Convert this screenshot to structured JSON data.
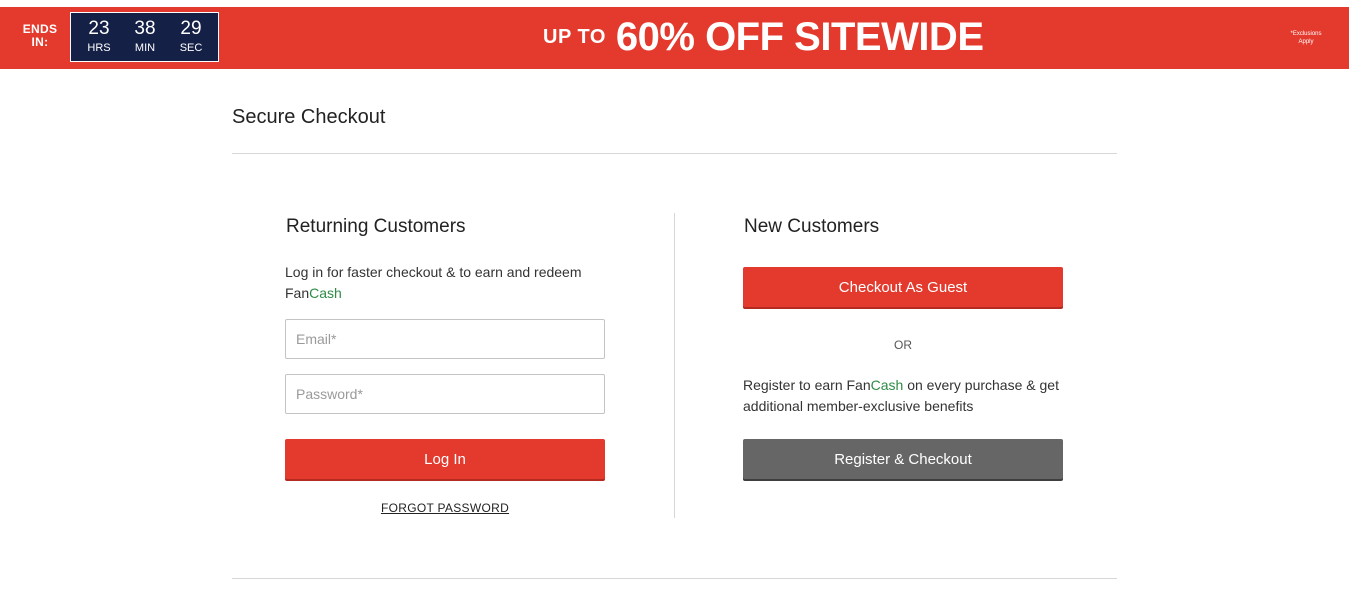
{
  "banner": {
    "ends_in_line1": "ENDS",
    "ends_in_line2": "IN:",
    "timer": {
      "hours": "23",
      "hours_label": "HRS",
      "minutes": "38",
      "minutes_label": "MIN",
      "seconds": "29",
      "seconds_label": "SEC"
    },
    "promo_prefix": "UP TO",
    "promo_main": "60% OFF SITEWIDE",
    "exclusions_line1": "*Exclusions",
    "exclusions_line2": "Apply",
    "colors": {
      "background": "#e4392d",
      "timer_background": "#152047"
    }
  },
  "page": {
    "title": "Secure Checkout"
  },
  "returning": {
    "heading": "Returning Customers",
    "description_prefix": "Log in for faster checkout & to earn and redeem Fan",
    "description_highlight": "Cash",
    "email_placeholder": "Email*",
    "email_value": "",
    "password_placeholder": "Password*",
    "password_value": "",
    "login_label": "Log In",
    "forgot_label": "FORGOT PASSWORD"
  },
  "new_customers": {
    "heading": "New Customers",
    "guest_label": "Checkout As Guest",
    "or_label": "OR",
    "register_text_prefix": "Register to earn Fan",
    "register_text_highlight": "Cash",
    "register_text_suffix": " on every purchase & get additional member-exclusive benefits",
    "register_label": "Register & Checkout"
  },
  "colors": {
    "accent": "#e4392d",
    "fancash_green": "#2e8b46",
    "secondary_button": "#666666"
  }
}
